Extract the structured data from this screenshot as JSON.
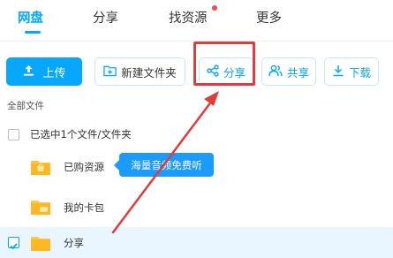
{
  "tabs": [
    {
      "label": "网盘",
      "active": true
    },
    {
      "label": "分享"
    },
    {
      "label": "找资源",
      "dot": true
    },
    {
      "label": "更多"
    }
  ],
  "toolbar": {
    "upload": "上传",
    "new_folder": "新建文件夹",
    "share": "分享",
    "co_share": "共享",
    "download": "下载"
  },
  "breadcrumb": "全部文件",
  "selection_text": "已选中1个文件/文件夹",
  "files": [
    {
      "name": "已购资源",
      "icon": "purchased-folder-icon"
    },
    {
      "name": "我的卡包",
      "icon": "card-folder-icon"
    },
    {
      "name": "分享",
      "icon": "folder-icon",
      "checked": true
    }
  ],
  "tooltip": "海量音频免费听",
  "colors": {
    "accent": "#06a7ff",
    "annotation": "#e13b3b",
    "folder": "#ffc83d"
  }
}
